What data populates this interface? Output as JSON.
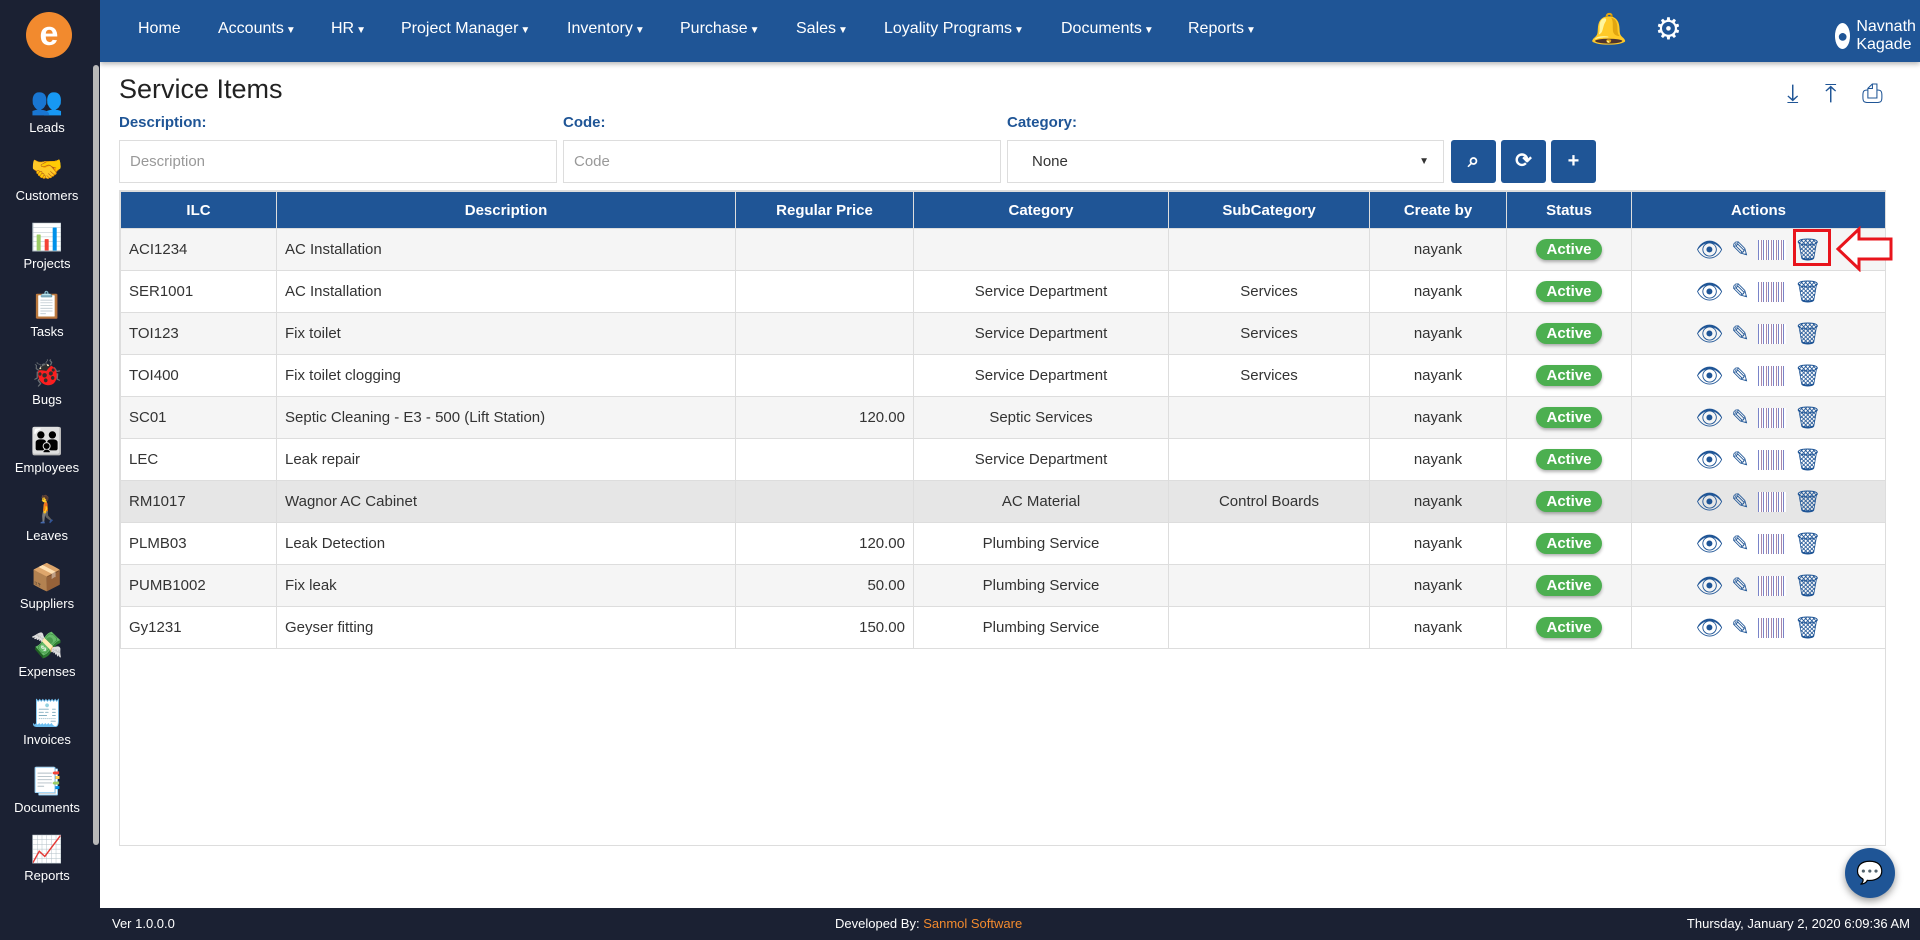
{
  "app": {
    "logo_letter": "e"
  },
  "sidebar": {
    "items": [
      {
        "label": "Leads",
        "icon": "leads-icon",
        "glyph": "👥"
      },
      {
        "label": "Customers",
        "icon": "customers-icon",
        "glyph": "🤝"
      },
      {
        "label": "Projects",
        "icon": "projects-icon",
        "glyph": "📊"
      },
      {
        "label": "Tasks",
        "icon": "tasks-icon",
        "glyph": "📋"
      },
      {
        "label": "Bugs",
        "icon": "bug-icon",
        "glyph": "🐞"
      },
      {
        "label": "Employees",
        "icon": "employees-icon",
        "glyph": "👪"
      },
      {
        "label": "Leaves",
        "icon": "leaves-icon",
        "glyph": "🚶"
      },
      {
        "label": "Suppliers",
        "icon": "suppliers-icon",
        "glyph": "📦"
      },
      {
        "label": "Expenses",
        "icon": "expenses-icon",
        "glyph": "💸"
      },
      {
        "label": "Invoices",
        "icon": "invoices-icon",
        "glyph": "🧾"
      },
      {
        "label": "Documents",
        "icon": "documents-icon",
        "glyph": "📑"
      },
      {
        "label": "Reports",
        "icon": "reports-icon",
        "glyph": "📈"
      }
    ]
  },
  "nav": {
    "items": [
      {
        "label": "Home",
        "dropdown": false
      },
      {
        "label": "Accounts",
        "dropdown": true
      },
      {
        "label": "HR",
        "dropdown": true
      },
      {
        "label": "Project Manager",
        "dropdown": true
      },
      {
        "label": "Inventory",
        "dropdown": true
      },
      {
        "label": "Purchase",
        "dropdown": true
      },
      {
        "label": "Sales",
        "dropdown": true
      },
      {
        "label": "Loyality Programs",
        "dropdown": true
      },
      {
        "label": "Documents",
        "dropdown": true
      },
      {
        "label": "Reports",
        "dropdown": true
      }
    ],
    "user": "Navnath Kagade"
  },
  "page": {
    "title": "Service Items"
  },
  "filters": {
    "description_label": "Description:",
    "description_placeholder": "Description",
    "code_label": "Code:",
    "code_placeholder": "Code",
    "category_label": "Category:",
    "category_value": "None"
  },
  "table": {
    "headers": [
      "ILC",
      "Description",
      "Regular Price",
      "Category",
      "SubCategory",
      "Create by",
      "Status",
      "Actions"
    ],
    "rows": [
      [
        "ACI1234",
        "AC Installation",
        "",
        "",
        "",
        "nayank",
        "Active"
      ],
      [
        "SER1001",
        "AC Installation",
        "",
        "Service Department",
        "Services",
        "nayank",
        "Active"
      ],
      [
        "TOI123",
        "Fix toilet",
        "",
        "Service Department",
        "Services",
        "nayank",
        "Active"
      ],
      [
        "TOI400",
        "Fix toilet clogging",
        "",
        "Service Department",
        "Services",
        "nayank",
        "Active"
      ],
      [
        "SC01",
        "Septic Cleaning - E3 - 500 (Lift Station)",
        "120.00",
        "Septic Services",
        "",
        "nayank",
        "Active"
      ],
      [
        "LEC",
        "Leak repair",
        "",
        "Service Department",
        "",
        "nayank",
        "Active"
      ],
      [
        "RM1017",
        "Wagnor AC Cabinet",
        "",
        "AC Material",
        "Control Boards",
        "nayank",
        "Active"
      ],
      [
        "PLMB03",
        "Leak Detection",
        "120.00",
        "Plumbing Service",
        "",
        "nayank",
        "Active"
      ],
      [
        "PUMB1002",
        "Fix leak",
        "50.00",
        "Plumbing Service",
        "",
        "nayank",
        "Active"
      ],
      [
        "Gy1231",
        "Geyser fitting",
        "150.00",
        "Plumbing Service",
        "",
        "nayank",
        "Active"
      ]
    ]
  },
  "footer": {
    "version": "Ver 1.0.0.0",
    "developed_by": "Developed By:",
    "company": "Sanmol Software",
    "datetime": "Thursday, January 2, 2020 6:09:36 AM"
  },
  "colors": {
    "primary": "#1f5596",
    "sidebar": "#1b2133",
    "active": "#4caf50",
    "accent": "#f28a2e",
    "highlight": "#e8141c"
  }
}
